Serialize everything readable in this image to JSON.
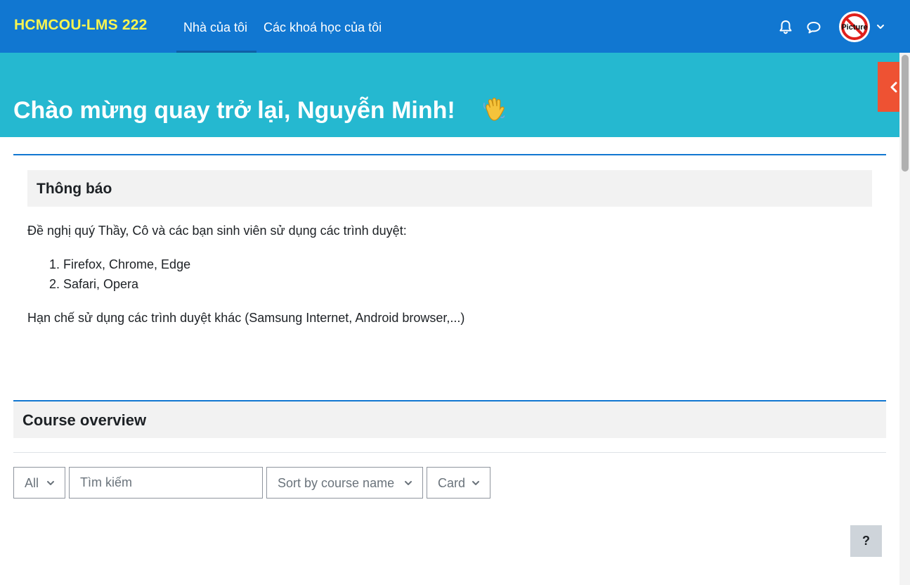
{
  "navbar": {
    "brand": "HCMCOU-LMS 222",
    "links": [
      {
        "label": "Nhà của tôi",
        "active": true
      },
      {
        "label": "Các khoá học của tôi",
        "active": false
      }
    ],
    "icons": [
      "bell-icon",
      "chat-bubble-icon",
      "chevron-down-icon"
    ],
    "avatar_text": "Picture",
    "colors": {
      "background": "#1177d1",
      "brand": "#f7f552"
    }
  },
  "banner": {
    "welcome": "Chào mừng quay trở lại, Nguyễn Minh!",
    "emoji": "👋",
    "color": "#25b8d0"
  },
  "drawer_toggle": {
    "icon": "chevron-left-icon",
    "color": "#ee5233"
  },
  "announcement": {
    "title": "Thông báo",
    "intro": "Đề nghị quý Thầy, Cô và các bạn sinh viên sử dụng các trình duyệt:",
    "items": [
      "1. Firefox, Chrome, Edge",
      "2. Safari, Opera"
    ],
    "footer": "Hạn chế sử dụng các trình duyệt khác (Samsung Internet, Android browser,...)"
  },
  "course_overview": {
    "title": "Course overview",
    "filter": {
      "selected": "All"
    },
    "search": {
      "placeholder": "Tìm kiếm",
      "value": ""
    },
    "sort": {
      "selected": "Sort by course name"
    },
    "view": {
      "selected": "Card"
    }
  },
  "help_button": {
    "label": "?"
  }
}
